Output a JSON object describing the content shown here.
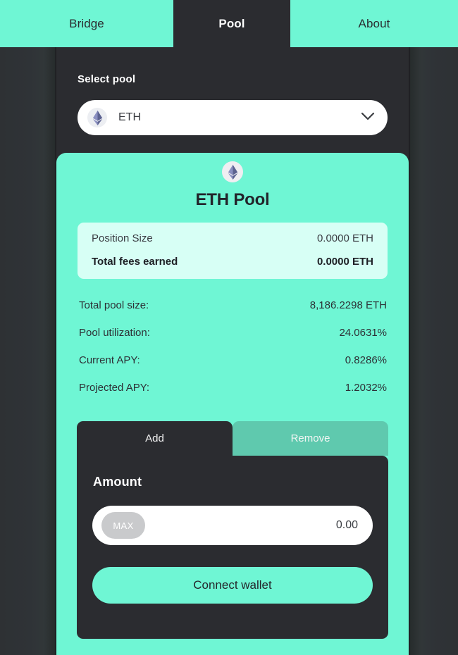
{
  "nav": {
    "tabs": [
      {
        "label": "Bridge",
        "active": false
      },
      {
        "label": "Pool",
        "active": true
      },
      {
        "label": "About",
        "active": false
      }
    ]
  },
  "select_pool": {
    "label": "Select pool",
    "value": "ETH",
    "token_icon": "ethereum-icon",
    "chevron_icon": "chevron-down-icon"
  },
  "pool": {
    "icon": "ethereum-icon",
    "title": "ETH Pool",
    "position_box": {
      "position_size_label": "Position Size",
      "position_size_value": "0.0000 ETH",
      "total_fees_label": "Total fees earned",
      "total_fees_value": "0.0000 ETH"
    },
    "stats": [
      {
        "label": "Total pool size:",
        "value": "8,186.2298 ETH"
      },
      {
        "label": "Pool utilization:",
        "value": "24.0631%"
      },
      {
        "label": "Current APY:",
        "value": "0.8286%"
      },
      {
        "label": "Projected APY:",
        "value": "1.2032%"
      }
    ],
    "action_tabs": [
      {
        "label": "Add",
        "active": true
      },
      {
        "label": "Remove",
        "active": false
      }
    ],
    "form": {
      "amount_label": "Amount",
      "max_label": "MAX",
      "amount_value": "0.00",
      "amount_placeholder": "0.00",
      "submit_label": "Connect wallet"
    }
  },
  "colors": {
    "mint": "#6ff6d4",
    "mint_muted": "#5fc9ae",
    "mint_pale": "#d7fff5",
    "dark": "#2b2c30",
    "white": "#ffffff"
  }
}
